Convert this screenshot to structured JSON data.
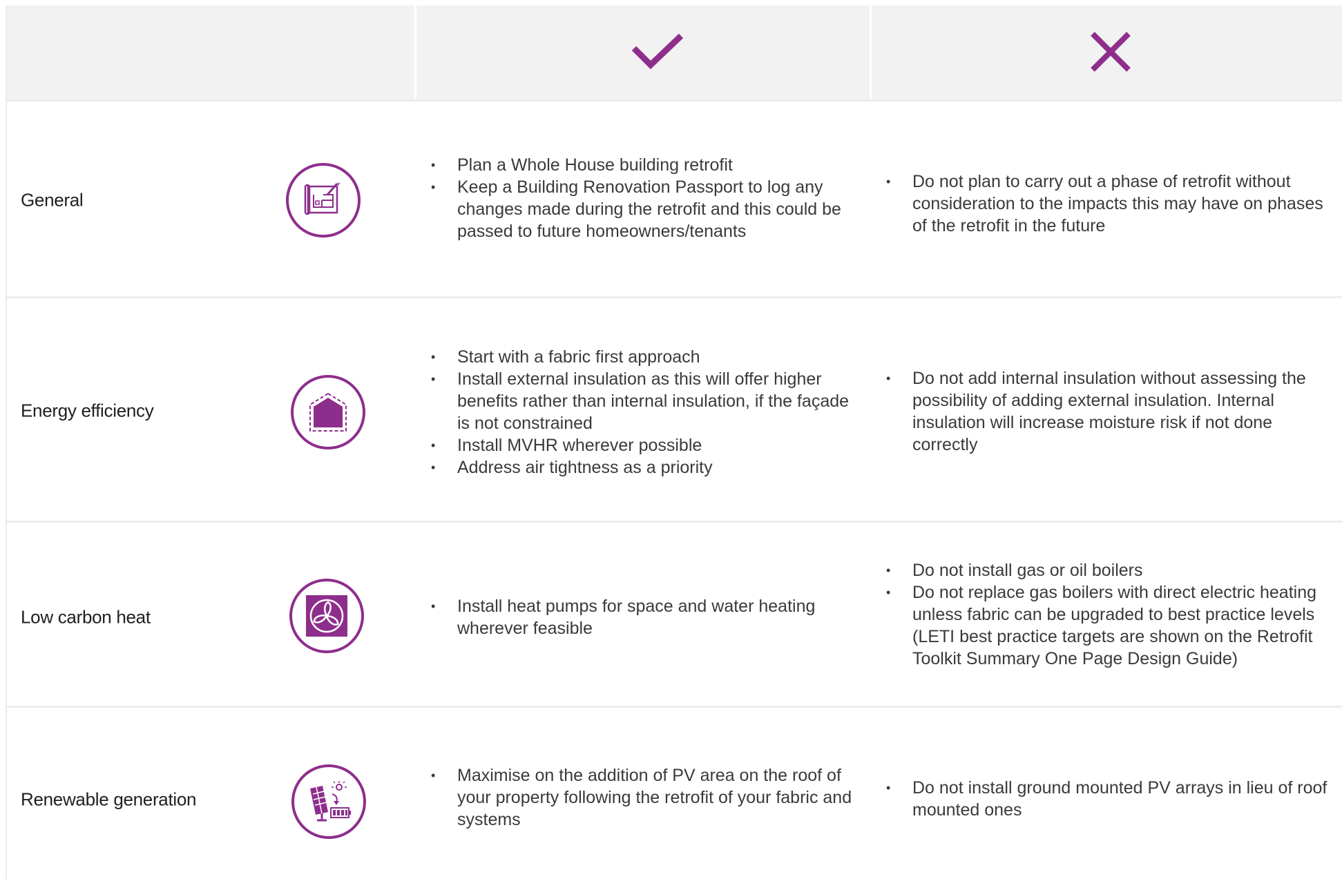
{
  "colors": {
    "accent": "#8e2e8c",
    "header_bg": "#f2f2f2",
    "divider": "#ececec"
  },
  "header": {
    "do_icon": "check-icon",
    "dont_icon": "cross-icon"
  },
  "rows": [
    {
      "category": "General",
      "icon": "blueprint-icon",
      "do": [
        "Plan a Whole House building retrofit",
        "Keep a Building Renovation Passport to log any changes made during the retrofit and this could be passed to future homeowners/tenants"
      ],
      "dont": [
        "Do not plan to carry out a phase of retrofit without consideration to the impacts this may have on phases of the retrofit in the future"
      ]
    },
    {
      "category": "Energy efficiency",
      "icon": "insulated-house-icon",
      "do": [
        "Start with a fabric first approach",
        "Install external insulation as this will offer higher benefits rather than internal insulation, if the façade is not constrained",
        "Install MVHR wherever possible",
        "Address air tightness as a priority"
      ],
      "dont": [
        "Do not add internal insulation without assessing the possibility of adding external insulation. Internal insulation will increase moisture risk if not done correctly"
      ]
    },
    {
      "category": "Low carbon heat",
      "icon": "heat-pump-fan-icon",
      "do": [
        "Install heat pumps for space and water heating wherever feasible"
      ],
      "dont": [
        "Do not install gas or oil boilers",
        "Do not replace gas boilers with direct electric heating unless fabric can be upgraded to best practice levels (LETI best practice targets are shown on the Retrofit Toolkit Summary One Page Design Guide)"
      ]
    },
    {
      "category": "Renewable generation",
      "icon": "solar-panel-battery-icon",
      "do": [
        "Maximise on the addition of PV area on the roof of your property following the retrofit of your fabric and systems"
      ],
      "dont": [
        "Do not install ground mounted PV arrays in lieu of roof mounted ones"
      ]
    }
  ]
}
